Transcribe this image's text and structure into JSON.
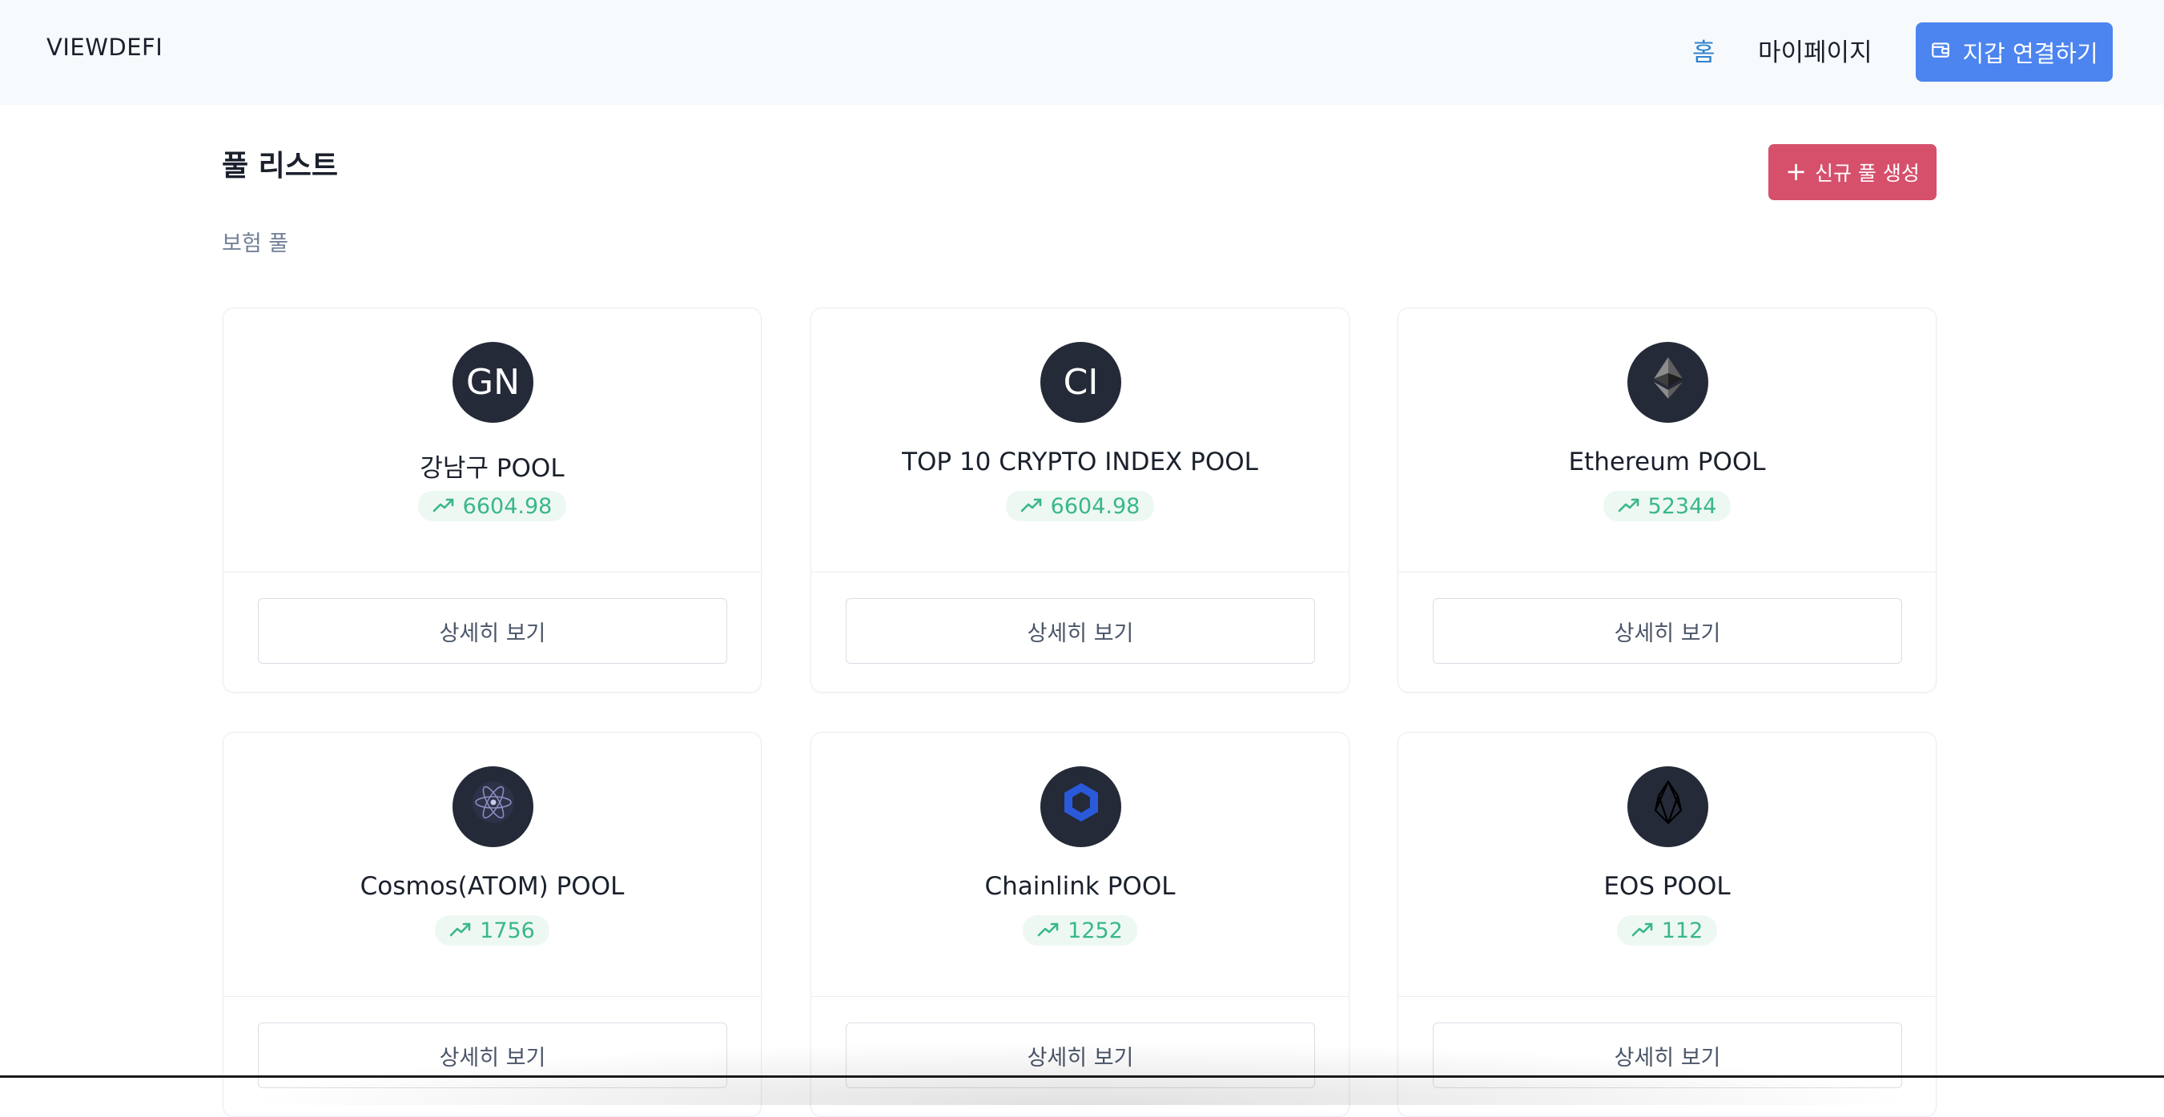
{
  "header": {
    "brand": "VIEWDEFI",
    "nav": {
      "home": "홈",
      "mypage": "마이페이지"
    },
    "wallet_button": "지갑 연결하기"
  },
  "main": {
    "title": "풀 리스트",
    "new_pool_button": "신규 풀 생성",
    "section_label": "보험 풀",
    "detail_label": "상세히 보기",
    "pools": [
      {
        "name": "강남구 POOL",
        "value": "6604.98",
        "avatar": "GN",
        "icon": "text-initials"
      },
      {
        "name": "TOP 10 CRYPTO INDEX POOL",
        "value": "6604.98",
        "avatar": "CI",
        "icon": "text-initials"
      },
      {
        "name": "Ethereum POOL",
        "value": "52344",
        "icon": "ethereum-logo-icon"
      },
      {
        "name": "Cosmos(ATOM) POOL",
        "value": "1756",
        "icon": "cosmos-logo-icon"
      },
      {
        "name": "Chainlink POOL",
        "value": "1252",
        "icon": "chainlink-logo-icon"
      },
      {
        "name": "EOS POOL",
        "value": "112",
        "icon": "eos-logo-icon"
      }
    ]
  },
  "colors": {
    "accent_blue": "#4c84f0",
    "nav_active": "#3182ce",
    "create_red": "#d6506c",
    "trend_green": "#38b887",
    "avatar_bg": "#252a38"
  }
}
